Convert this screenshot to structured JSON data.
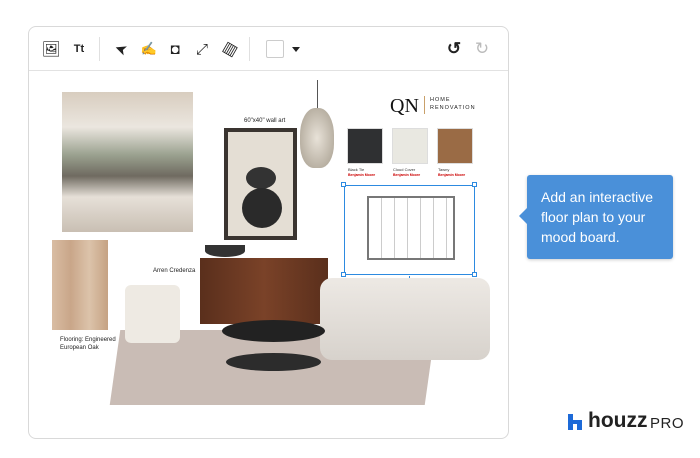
{
  "toolbar": {
    "tools": [
      {
        "name": "image-icon",
        "glyph": "🖼"
      },
      {
        "name": "text-icon",
        "glyph": "Tt"
      },
      {
        "name": "select-arrow-icon",
        "glyph": "➤"
      },
      {
        "name": "draw-icon",
        "glyph": "✍"
      },
      {
        "name": "arrange-layers-icon",
        "glyph": "◘"
      },
      {
        "name": "resize-icon",
        "glyph": "⤢"
      },
      {
        "name": "ruler-icon",
        "glyph": "▤"
      }
    ],
    "color_value": "#ffffff",
    "undo_glyph": "↺",
    "redo_glyph": "↻"
  },
  "board": {
    "wall_art_label": "60\"x40\" wall art",
    "logo": {
      "mark": "QN",
      "line1": "HOME",
      "line2": "RENOVATION"
    },
    "swatches": [
      {
        "name": "Black Tie",
        "brand": "Benjamin Moore",
        "color": "#2f3032"
      },
      {
        "name": "Cloud Cover",
        "brand": "Benjamin Moore",
        "color": "#e9e8e1"
      },
      {
        "name": "Tawny",
        "brand": "Benjamin Moore",
        "color": "#9a6b45"
      }
    ],
    "credenza_label": "Arren Credenza",
    "flooring_label": "Flooring: Engineered European Oak"
  },
  "tooltip": {
    "text": "Add an interactive floor plan to your mood board."
  },
  "brand": {
    "name": "houzz",
    "suffix": "PRO",
    "color": "#1d6ad8"
  },
  "colors": {
    "selection": "#2d8ae0",
    "tooltip_bg": "#4a90d9"
  }
}
